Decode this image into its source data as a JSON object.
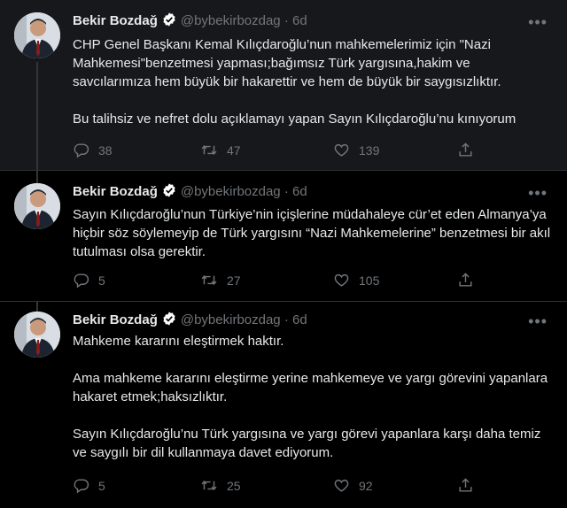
{
  "tweets": [
    {
      "author": "Bekir Bozdağ",
      "handle": "@bybekirbozdag",
      "separator": "·",
      "time": "6d",
      "paragraphs": [
        "CHP Genel Başkanı Kemal Kılıçdaroğlu’nun mahkemelerimiz için \"Nazi Mahkemesi\"benzetmesi yapması;bağımsız Türk yargısına,hakim ve savcılarımıza hem büyük bir hakarettir ve hem de büyük bir saygısızlıktır.",
        "Bu talihsiz ve nefret dolu açıklamayı yapan Sayın Kılıçdaroğlu’nu kınıyorum"
      ],
      "replies": "38",
      "retweets": "47",
      "likes": "139"
    },
    {
      "author": "Bekir Bozdağ",
      "handle": "@bybekirbozdag",
      "separator": "·",
      "time": "6d",
      "paragraphs": [
        "Sayın Kılıçdaroğlu’nun Türkiye’nin içişlerine müdahaleye cür’et eden Almanya’ya hiçbir söz söylemeyip de Türk yargısını “Nazi Mahkemelerine” benzetmesi bir akıl tutulması olsa gerektir."
      ],
      "replies": "5",
      "retweets": "27",
      "likes": "105"
    },
    {
      "author": "Bekir Bozdağ",
      "handle": "@bybekirbozdag",
      "separator": "·",
      "time": "6d",
      "paragraphs": [
        "Mahkeme kararını eleştirmek haktır.",
        "Ama mahkeme kararını eleştirme yerine mahkemeye ve yargı görevini yapanlara hakaret etmek;haksızlıktır.",
        "Sayın Kılıçdaroğlu’nu Türk yargısına ve yargı görevi yapanlara karşı daha temiz ve saygılı bir dil kullanmaya davet ediyorum."
      ],
      "replies": "5",
      "retweets": "25",
      "likes": "92"
    }
  ],
  "icons": {
    "reply": "reply-icon",
    "retweet": "retweet-icon",
    "like": "like-icon",
    "share": "share-icon",
    "verified": "verified-badge-icon",
    "more": "more-options-icon"
  },
  "colors": {
    "background": "#000000",
    "highlighted_background": "#16181c",
    "text": "#e7e9ea",
    "muted": "#71767b",
    "verified_badge": "#ffffff"
  }
}
